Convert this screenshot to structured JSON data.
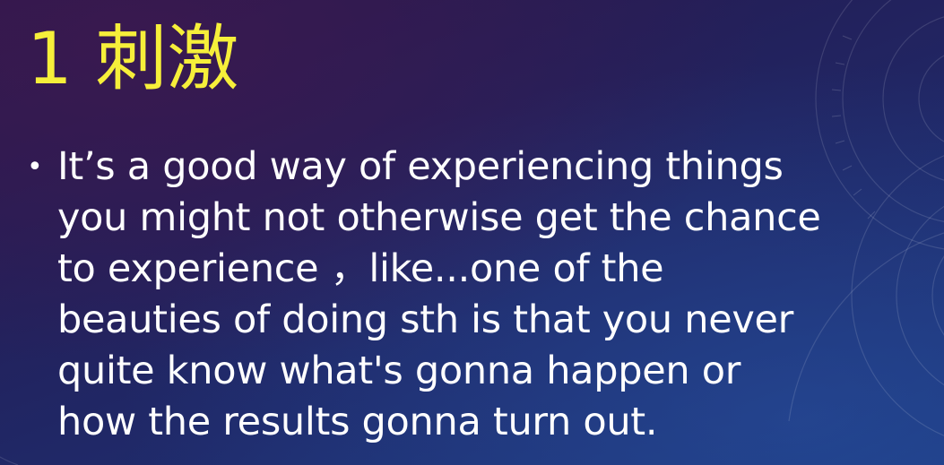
{
  "slide": {
    "title": "1 刺激",
    "bullet": {
      "marker": "•",
      "lines": [
        "It’s a good way of experiencing things",
        "you might not otherwise get the chance",
        "to experience ，like...one of the",
        "beauties of doing sth is that you never",
        "quite know what's gonna happen or",
        "how the results gonna turn out."
      ]
    },
    "colors": {
      "title": "#f6ef3a",
      "text": "#ffffff",
      "background_top": "#2b1748",
      "background_bottom": "#1d3a80"
    }
  }
}
